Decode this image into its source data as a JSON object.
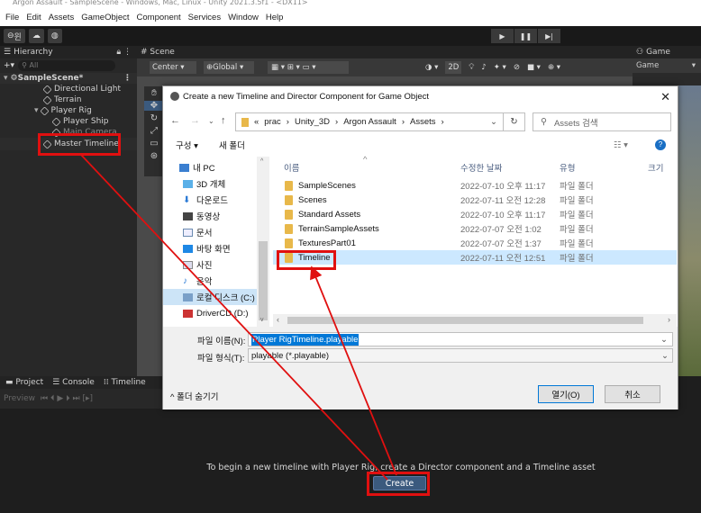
{
  "titlebar": {
    "text": "Argon Assault - SampleScene - Windows, Mac, Linux - Unity 2021.3.5f1 - <DX11>"
  },
  "menubar": {
    "items": [
      "File",
      "Edit",
      "Assets",
      "GameObject",
      "Component",
      "Services",
      "Window",
      "Help"
    ]
  },
  "toolbar": {
    "account": "윈",
    "play": "▶",
    "pause": "❚❚",
    "step": "▶|"
  },
  "hierarchy": {
    "tab": "Hierarchy",
    "search_placeholder": "All",
    "add": "+▾",
    "scene": "SampleScene*",
    "items": [
      "Directional Light",
      "Terrain",
      "Player Rig",
      "Player Ship",
      "Main Camera",
      "Master Timeline"
    ]
  },
  "scene": {
    "tab": "Scene",
    "center": "Center",
    "global": "Global",
    "mode_2d": "2D"
  },
  "game": {
    "tab": "Game",
    "display": "Game"
  },
  "bottom": {
    "tabs": [
      "Project",
      "Console",
      "Timeline"
    ],
    "preview": "Preview",
    "message": "To begin a new timeline with Player Rig, create a Director component and a Timeline asset",
    "create": "Create"
  },
  "dialog": {
    "title": "Create a new Timeline and Director Component for Game Object",
    "breadcrumb": [
      "«",
      "prac",
      "Unity_3D",
      "Argon Assault",
      "Assets"
    ],
    "search_placeholder": "Assets 검색",
    "organize": "구성 ▾",
    "new_folder": "새 폴더",
    "nav": [
      "내 PC",
      "3D 개체",
      "다운로드",
      "동영상",
      "문서",
      "바탕 화면",
      "사진",
      "음악",
      "로컬 디스크 (C:)",
      "DriverCD (D:)"
    ],
    "columns": {
      "name": "이름",
      "date": "수정한 날짜",
      "type": "유형",
      "size": "크기"
    },
    "files": [
      {
        "name": "SampleScenes",
        "date": "2022-07-10 오후 11:17",
        "type": "파일 폴더"
      },
      {
        "name": "Scenes",
        "date": "2022-07-11 오전 12:28",
        "type": "파일 폴더"
      },
      {
        "name": "Standard Assets",
        "date": "2022-07-10 오후 11:17",
        "type": "파일 폴더"
      },
      {
        "name": "TerrainSampleAssets",
        "date": "2022-07-07 오전 1:02",
        "type": "파일 폴더"
      },
      {
        "name": "TexturesPart01",
        "date": "2022-07-07 오전 1:37",
        "type": "파일 폴더"
      },
      {
        "name": "Timeline",
        "date": "2022-07-11 오전 12:51",
        "type": "파일 폴더"
      }
    ],
    "filename_label": "파일 이름(N):",
    "filename_value": "Player RigTimeline.playable",
    "filetype_label": "파일 형식(T):",
    "filetype_value": "playable (*.playable)",
    "hide_folders": "폴더 숨기기",
    "open": "열기(O)",
    "cancel": "취소"
  },
  "colors": {
    "highlight": "#e01010",
    "unity_dark": "#282828",
    "create_button": "#3b5a7e",
    "selection": "#cce8ff"
  }
}
